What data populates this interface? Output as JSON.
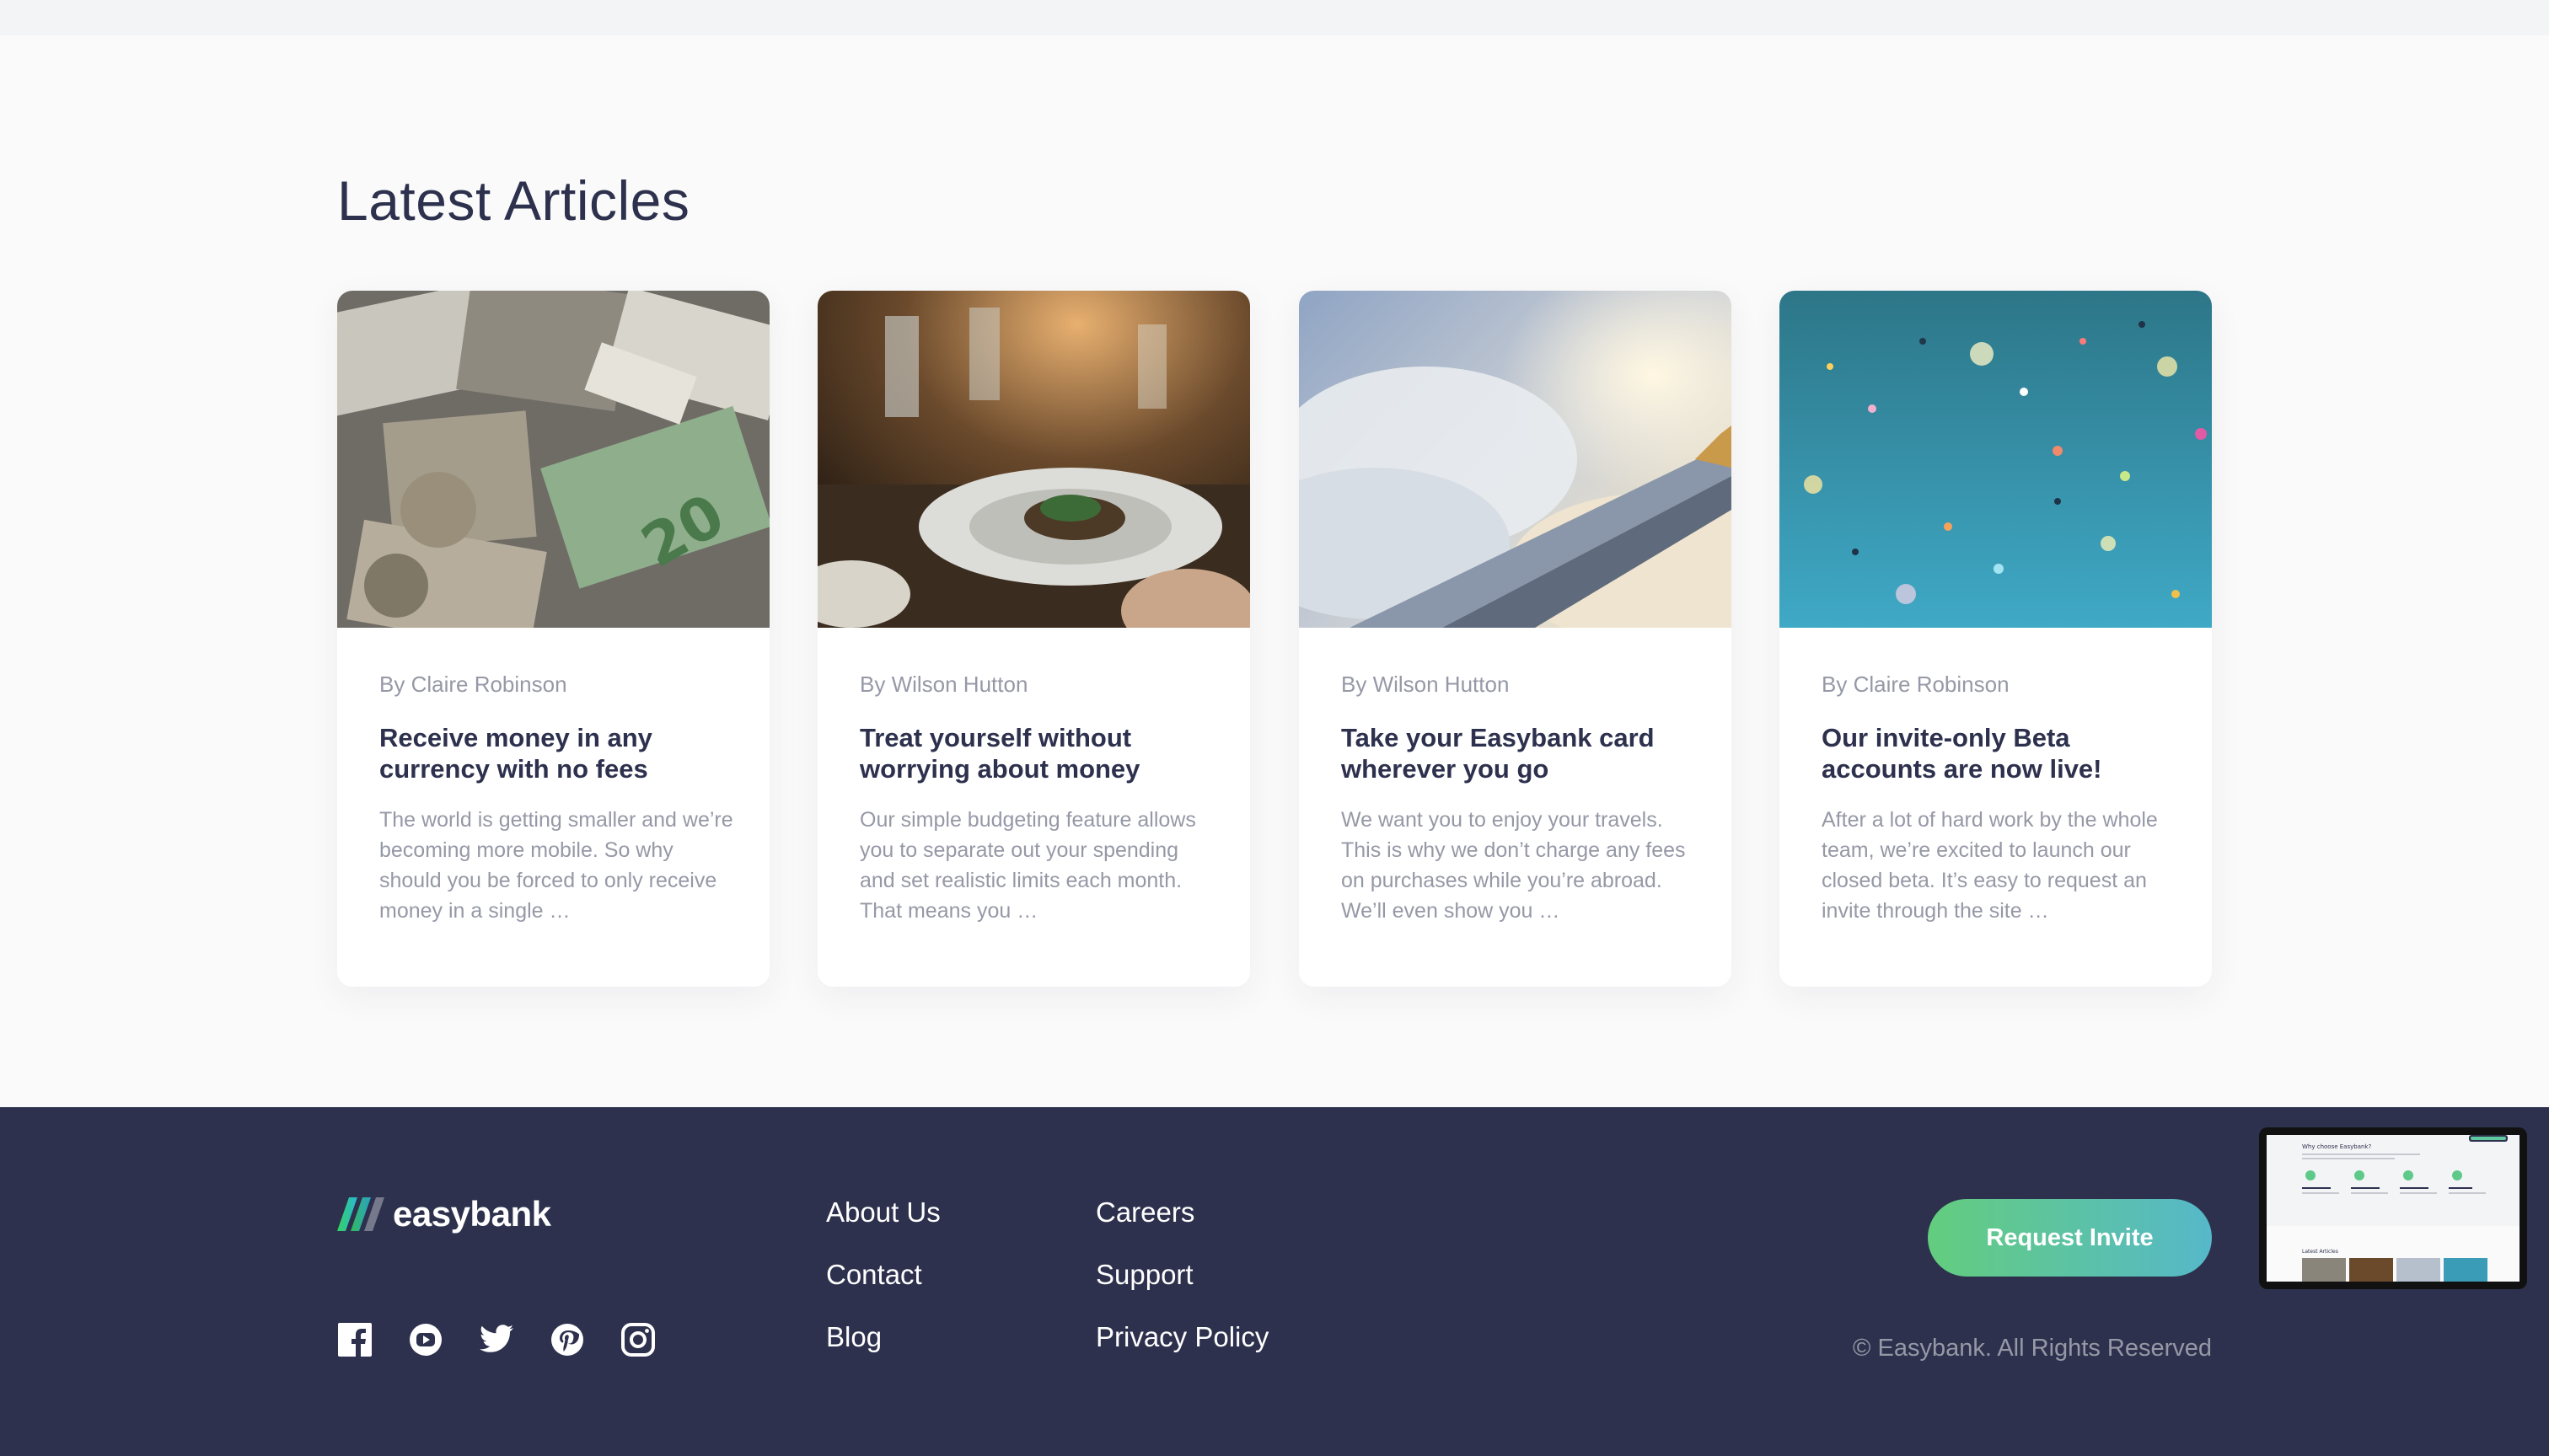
{
  "articles_section": {
    "title": "Latest Articles",
    "cards": [
      {
        "author": "By Claire Robinson",
        "title": "Receive money in any currency with no fees",
        "excerpt": "The world is getting smaller and we’re becoming more mobile. So why should you be forced to only receive money in a single …",
        "image": "currency-banknotes"
      },
      {
        "author": "By Wilson Hutton",
        "title": "Treat yourself without worrying about money",
        "excerpt": "Our simple budgeting feature allows you to separate out your spending and set realistic limits each month. That means you …",
        "image": "restaurant-dinner"
      },
      {
        "author": "By Wilson Hutton",
        "title": "Take your Easybank card wherever you go",
        "excerpt": "We want you to enjoy your travels. This is why we don’t charge any fees on purchases while you’re abroad. We’ll even show you …",
        "image": "airplane-wing-clouds"
      },
      {
        "author": "By Claire Robinson",
        "title": "Our invite-only Beta accounts are now live!",
        "excerpt": "After a lot of hard work by the whole team, we’re excited to launch our closed beta. It’s easy to request an invite through the site …",
        "image": "confetti"
      }
    ]
  },
  "footer": {
    "logo_text": "easybank",
    "socials": [
      "facebook-icon",
      "youtube-icon",
      "twitter-icon",
      "pinterest-icon",
      "instagram-icon"
    ],
    "links_col1": [
      "About Us",
      "Contact",
      "Blog"
    ],
    "links_col2": [
      "Careers",
      "Support",
      "Privacy Policy"
    ],
    "cta_label": "Request Invite",
    "copyright": "© Easybank. All Rights Reserved"
  },
  "mini_preview": {
    "heading": "Why choose Easybank?",
    "sub_heading": "Latest Articles"
  },
  "colors": {
    "dark_blue": "#2d314d",
    "grayish_blue": "#9698a6",
    "lime_green": "#31d35c",
    "bright_cyan": "#2bb7da",
    "light_bg": "#fafafa"
  }
}
